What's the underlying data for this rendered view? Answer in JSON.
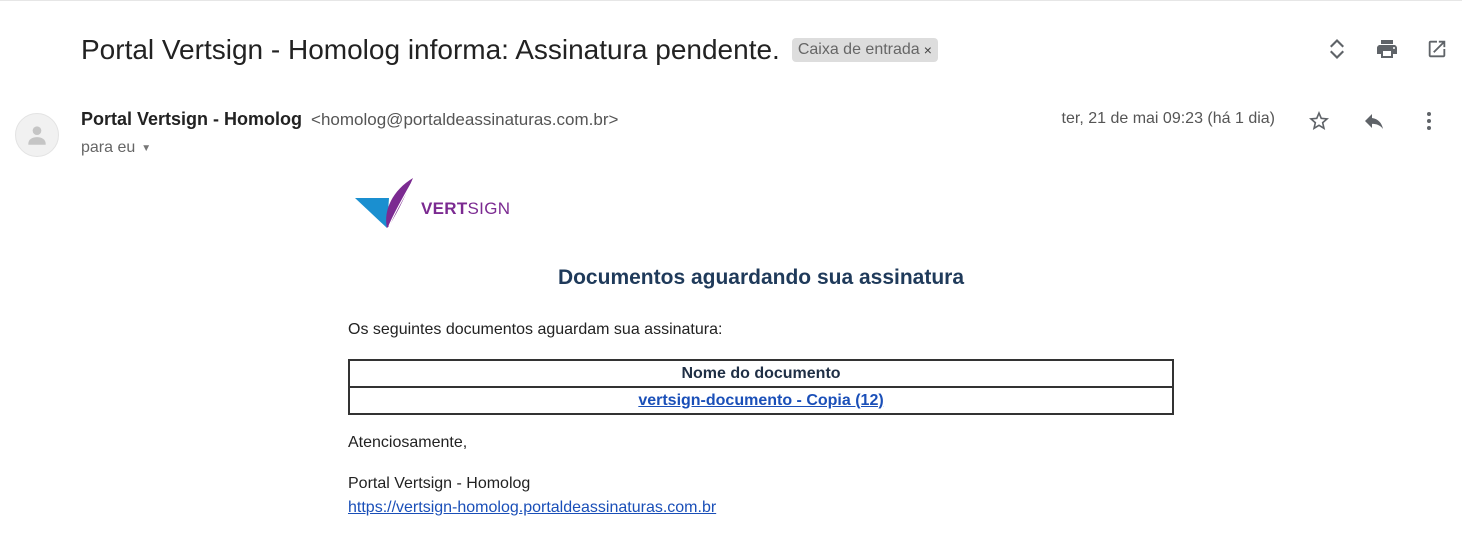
{
  "email": {
    "subject": "Portal Vertsign - Homolog informa: Assinatura pendente.",
    "label": "Caixa de entrada",
    "label_remove": "×",
    "sender_name": "Portal Vertsign - Homolog",
    "sender_email": "<homolog@portaldeassinaturas.com.br>",
    "recipient": "para eu",
    "date": "ter, 21 de mai 09:23 (há 1 dia)"
  },
  "icons": {
    "expand": "unfold-icon",
    "print": "print-icon",
    "new_window": "open-in-new-icon",
    "star": "star-icon",
    "reply": "reply-icon",
    "more": "more-vert-icon",
    "avatar": "person-icon"
  },
  "body": {
    "logo_vert": "VERT",
    "logo_sign": "SIGN",
    "headline": "Documentos aguardando sua assinatura",
    "intro": "Os seguintes documentos aguardam sua assinatura:",
    "table_header": "Nome do documento",
    "documents": [
      "vertsign-documento - Copia (12)"
    ],
    "regards": "Atenciosamente,",
    "signature_name": "Portal Vertsign - Homolog",
    "signature_url": "https://vertsign-homolog.portaldeassinaturas.com.br"
  },
  "colors": {
    "brand_purple": "#7b2a91",
    "brand_blue": "#1a8fd0",
    "headline": "#1f3a5a",
    "link": "#1a4fb8"
  }
}
